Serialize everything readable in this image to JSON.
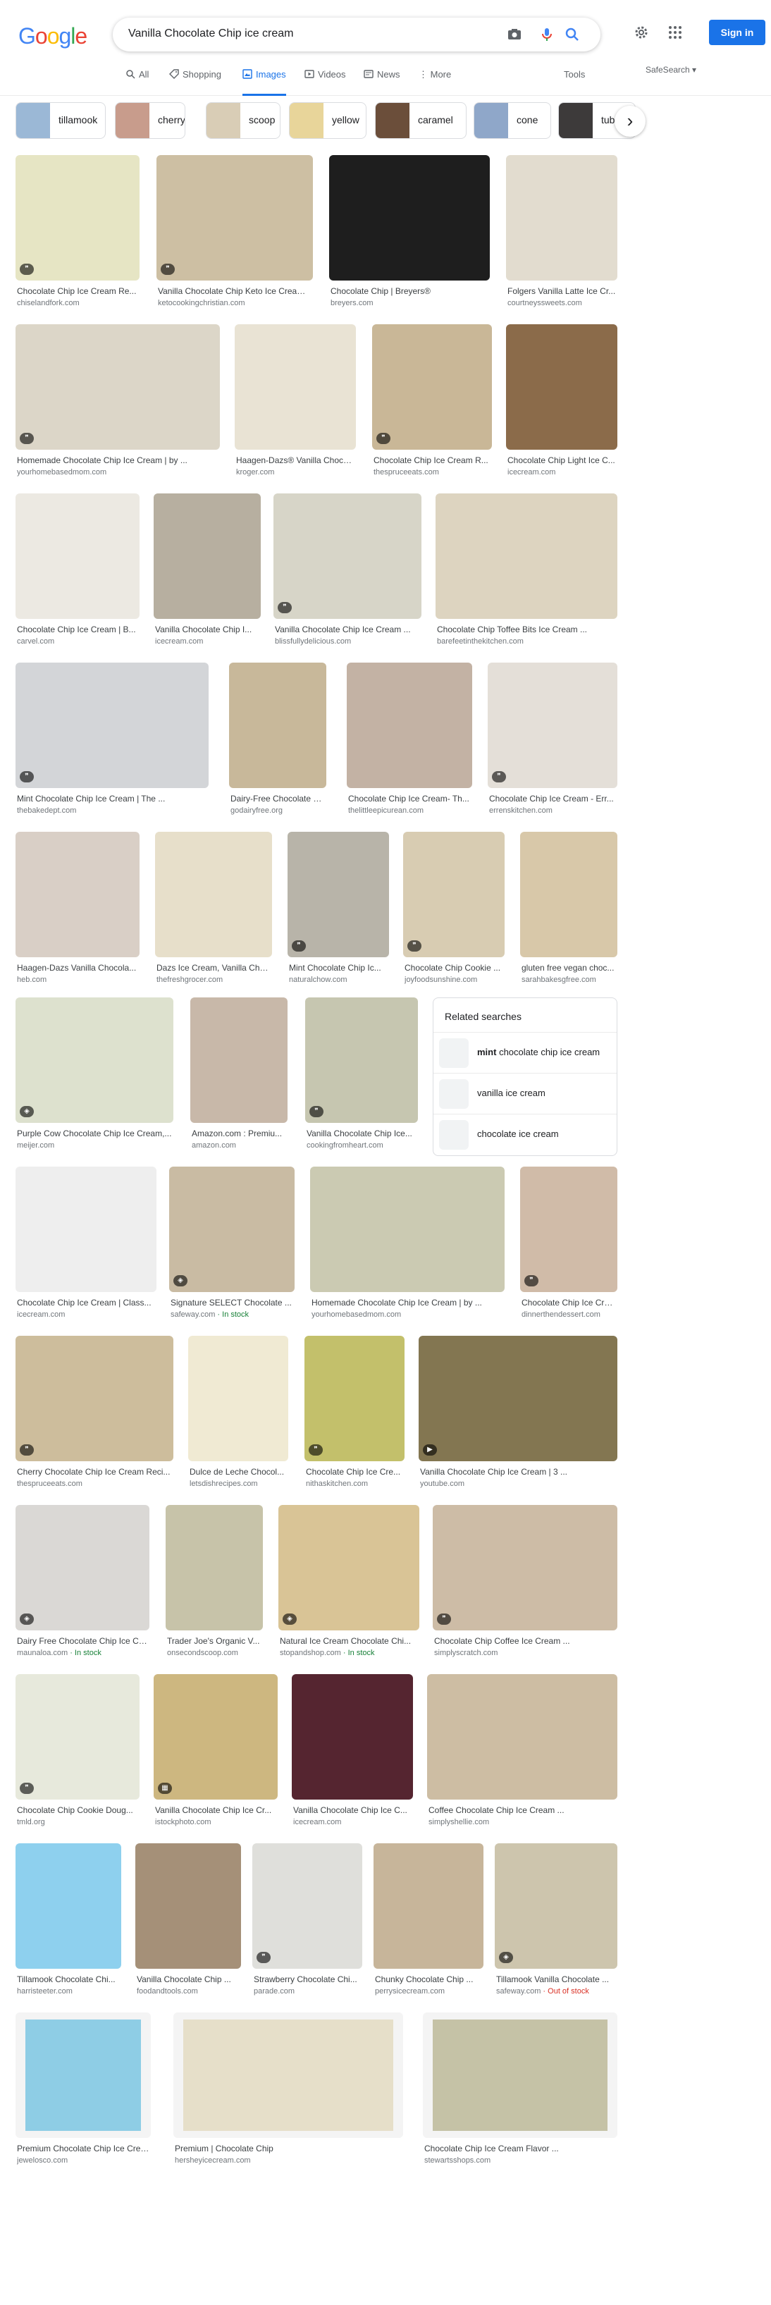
{
  "logo": {
    "letters": [
      "G",
      "o",
      "o",
      "g",
      "l",
      "e"
    ],
    "colors": [
      "#4285f4",
      "#ea4335",
      "#fbbc05",
      "#4285f4",
      "#34a853",
      "#ea4335"
    ]
  },
  "search": {
    "query": "Vanilla Chocolate Chip ice cream"
  },
  "header": {
    "sign_in": "Sign in",
    "safesearch": "SafeSearch ▾",
    "tools": "Tools"
  },
  "tabs": [
    {
      "label": "All"
    },
    {
      "label": "Shopping"
    },
    {
      "label": "Images"
    },
    {
      "label": "Videos"
    },
    {
      "label": "News"
    },
    {
      "label": "⋮ More"
    }
  ],
  "chips": [
    {
      "label": "tillamook",
      "color": "#9bb8d6"
    },
    {
      "label": "cherry",
      "color": "#c89c8c"
    },
    {
      "label": "scoop",
      "color": "#d9cdb6"
    },
    {
      "label": "yellow",
      "color": "#e8d59a"
    },
    {
      "label": "caramel",
      "color": "#6b4e3a"
    },
    {
      "label": "cone",
      "color": "#8fa7c9"
    },
    {
      "label": "tub",
      "color": "#3d3a3a"
    }
  ],
  "chip_next": "›",
  "related": {
    "heading": "Related searches",
    "items": [
      {
        "bold": "mint",
        "rest": " chocolate chip ice cream"
      },
      {
        "bold": "",
        "rest": "vanilla ice cream"
      },
      {
        "bold": "",
        "rest": "chocolate ice cream"
      }
    ]
  },
  "results": [
    {
      "title": "Chocolate Chip Ice Cream Re...",
      "src": "chiselandfork.com",
      "color": "#e6e5c4",
      "badge": "❞"
    },
    {
      "title": "Vanilla Chocolate Chip Keto Ice Cream ...",
      "src": "ketocookingchristian.com",
      "color": "#cdbfa3",
      "badge": "❞"
    },
    {
      "title": "Chocolate Chip | Breyers®",
      "src": "breyers.com",
      "color": "#1e1e1e",
      "badge": ""
    },
    {
      "title": "Folgers Vanilla Latte Ice Cr...",
      "src": "courtneyssweets.com",
      "color": "#e2dccf",
      "badge": ""
    },
    {
      "title": "Homemade Chocolate Chip Ice Cream | by ...",
      "src": "yourhomebasedmom.com",
      "color": "#dcd6c8",
      "badge": "❞"
    },
    {
      "title": "Haagen-Dazs® Vanilla Choco...",
      "src": "kroger.com",
      "color": "#e9e3d4",
      "badge": ""
    },
    {
      "title": "Chocolate Chip Ice Cream R...",
      "src": "thespruceeats.com",
      "color": "#c9b797",
      "badge": "❞"
    },
    {
      "title": "Chocolate Chip Light Ice C...",
      "src": "icecream.com",
      "color": "#8b6b4a",
      "badge": ""
    },
    {
      "title": "Chocolate Chip Ice Cream | B...",
      "src": "carvel.com",
      "color": "#ece9e2",
      "badge": ""
    },
    {
      "title": "Vanilla Chocolate Chip I...",
      "src": "icecream.com",
      "color": "#b7afa0",
      "badge": ""
    },
    {
      "title": "Vanilla Chocolate Chip Ice Cream ...",
      "src": "blissfullydelicious.com",
      "color": "#d7d5c8",
      "badge": "❞"
    },
    {
      "title": "Chocolate Chip Toffee Bits Ice Cream ...",
      "src": "barefeetinthekitchen.com",
      "color": "#ddd4c0",
      "badge": ""
    },
    {
      "title": "Mint Chocolate Chip Ice Cream | The ...",
      "src": "thebakedept.com",
      "color": "#d3d5d8",
      "badge": "❞"
    },
    {
      "title": "Dairy-Free Chocolate Chi...",
      "src": "godairyfree.org",
      "color": "#c8b89a",
      "badge": ""
    },
    {
      "title": "Chocolate Chip Ice Cream- Th...",
      "src": "thelittleepicurean.com",
      "color": "#c3b2a4",
      "badge": ""
    },
    {
      "title": "Chocolate Chip Ice Cream - Err...",
      "src": "errenskitchen.com",
      "color": "#e4dfd8",
      "badge": "❞"
    },
    {
      "title": "Haagen-Dazs Vanilla Chocola...",
      "src": "heb.com",
      "color": "#d9cfc6",
      "badge": ""
    },
    {
      "title": "Dazs Ice Cream, Vanilla Cho...",
      "src": "thefreshgrocer.com",
      "color": "#e7dfca",
      "badge": ""
    },
    {
      "title": "Mint Chocolate Chip Ic...",
      "src": "naturalchow.com",
      "color": "#b8b4a9",
      "badge": "❞"
    },
    {
      "title": "Chocolate Chip Cookie ...",
      "src": "joyfoodsunshine.com",
      "color": "#d8ccb2",
      "badge": "❞"
    },
    {
      "title": "gluten free vegan choc...",
      "src": "sarahbakesgfree.com",
      "color": "#d8c8a9",
      "badge": ""
    },
    {
      "title": "Purple Cow Chocolate Chip Ice Cream,...",
      "src": "meijer.com",
      "color": "#dde1ce",
      "badge": "◈"
    },
    {
      "title": "Amazon.com : Premiu...",
      "src": "amazon.com",
      "color": "#c8b8a9",
      "badge": ""
    },
    {
      "title": "Vanilla Chocolate Chip Ice...",
      "src": "cookingfromheart.com",
      "color": "#c6c6b0",
      "badge": "❞"
    },
    {
      "title": "Chocolate Chip Ice Cream | Class...",
      "src": "icecream.com",
      "color": "#eeeeee",
      "badge": ""
    },
    {
      "title": "Signature SELECT Chocolate ...",
      "src": "safeway.com",
      "stock": " · In stock",
      "color": "#c9bba3",
      "badge": "◈"
    },
    {
      "title": "Homemade Chocolate Chip Ice Cream | by ...",
      "src": "yourhomebasedmom.com",
      "color": "#cbcab2",
      "badge": ""
    },
    {
      "title": "Chocolate Chip Ice Cre...",
      "src": "dinnerthendessert.com",
      "color": "#d0bba8",
      "badge": "❞"
    },
    {
      "title": "Cherry Chocolate Chip Ice Cream Reci...",
      "src": "thespruceeats.com",
      "color": "#cdbd9c",
      "badge": "❞"
    },
    {
      "title": "Dulce de Leche Chocol...",
      "src": "letsdishrecipes.com",
      "color": "#f0ead3",
      "badge": ""
    },
    {
      "title": "Chocolate Chip Ice Cre...",
      "src": "nithaskitchen.com",
      "color": "#c3c06b",
      "badge": "❞"
    },
    {
      "title": "Vanilla Chocolate Chip Ice Cream | 3 ...",
      "src": "youtube.com",
      "color": "#837651",
      "badge": "▶"
    },
    {
      "title": "Dairy Free Chocolate Chip Ice Cr...",
      "src": "maunaloa.com",
      "stock": " · In stock",
      "color": "#dad8d5",
      "badge": "◈"
    },
    {
      "title": "Trader Joe's Organic V...",
      "src": "onsecondscoop.com",
      "color": "#c7c3a9",
      "badge": ""
    },
    {
      "title": "Natural Ice Cream Chocolate Chi...",
      "src": "stopandshop.com",
      "stock": " · In stock",
      "color": "#d9c496",
      "badge": "◈"
    },
    {
      "title": "Chocolate Chip Coffee Ice Cream ...",
      "src": "simplyscratch.com",
      "color": "#cdbca6",
      "badge": "❞"
    },
    {
      "title": "Chocolate Chip Cookie Doug...",
      "src": "tmld.org",
      "color": "#e7e9dc",
      "badge": "❞"
    },
    {
      "title": "Vanilla Chocolate Chip Ice Cr...",
      "src": "istockphoto.com",
      "color": "#cdb780",
      "badge": "▦"
    },
    {
      "title": "Vanilla Chocolate Chip Ice C...",
      "src": "icecream.com",
      "color": "#552530",
      "badge": ""
    },
    {
      "title": "Coffee Chocolate Chip Ice Cream ...",
      "src": "simplyshellie.com",
      "color": "#cdbda3",
      "badge": ""
    },
    {
      "title": "Tillamook Chocolate Chi...",
      "src": "harristeeter.com",
      "color": "#8ed0ee",
      "badge": ""
    },
    {
      "title": "Vanilla Chocolate Chip ...",
      "src": "foodandtools.com",
      "color": "#a59078",
      "badge": ""
    },
    {
      "title": "Strawberry Chocolate Chi...",
      "src": "parade.com",
      "color": "#dfdfdb",
      "badge": "❞"
    },
    {
      "title": "Chunky Chocolate Chip ...",
      "src": "perrysicecream.com",
      "color": "#c7b59a",
      "badge": ""
    },
    {
      "title": "Tillamook Vanilla Chocolate ...",
      "src": "safeway.com",
      "oos": " · Out of stock",
      "color": "#cdc5ad",
      "badge": "◈"
    },
    {
      "title": "Premium Chocolate Chip Ice Crea...",
      "src": "jewelosco.com",
      "color": "#8ecde5",
      "inner": true,
      "badge": ""
    },
    {
      "title": "Premium | Chocolate Chip",
      "src": "hersheyicecream.com",
      "color": "#e6dfc9",
      "inner": true,
      "badge": ""
    },
    {
      "title": "Chocolate Chip Ice Cream Flavor ...",
      "src": "stewartsshops.com",
      "color": "#c5c2a6",
      "inner": true,
      "badge": ""
    }
  ]
}
